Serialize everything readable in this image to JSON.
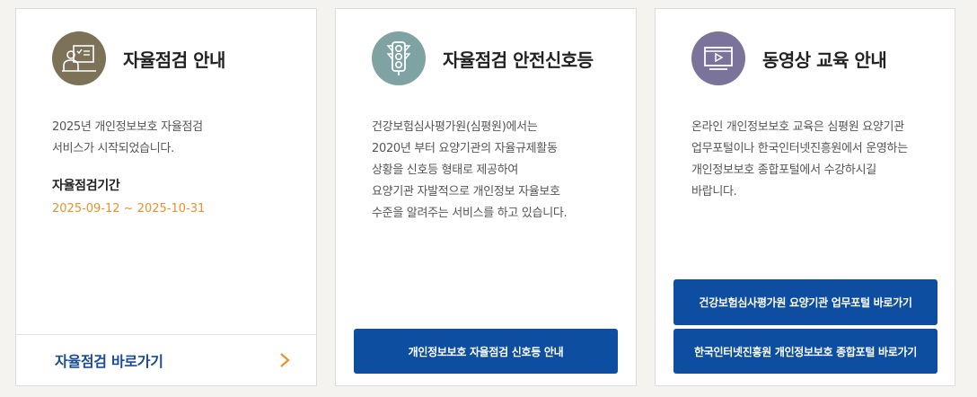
{
  "cards": [
    {
      "title": "자율점검 안내",
      "icon": "presentation-icon",
      "icon_bg": "#7b7258",
      "description": [
        "2025년 개인정보보호 자율점검",
        "서비스가 시작되었습니다."
      ],
      "period_label": "자율점검기간",
      "period_value": "2025-09-12 ~ 2025-10-31",
      "link_label": "자율점검 바로가기"
    },
    {
      "title": "자율점검 안전신호등",
      "icon": "traffic-light-icon",
      "icon_bg": "#7ea3a2",
      "description": [
        "건강보험심사평가원(심평원)에서는",
        "2020년 부터 요양기관의 자율규제활동",
        "상황을 신호등 형태로 제공하여",
        "요양기관 자발적으로 개인정보 자율보호",
        "수준을 알려주는 서비스를 하고 있습니다."
      ],
      "button_label": "개인정보보호 자율점검 신호등 안내"
    },
    {
      "title": "동영상 교육 안내",
      "icon": "video-player-icon",
      "icon_bg": "#7c739b",
      "description": [
        "온라인 개인정보보호 교육은 심평원 요양기관",
        "업무포털이나 한국인터넷진흥원에서 운영하는",
        "개인정보보호 종합포털에서 수강하시길",
        "바랍니다."
      ],
      "buttons": [
        "건강보험심사평가원 요양기관 업무포털 바로가기",
        "한국인터넷진흥원 개인정보보호 종합포털 바로가기"
      ]
    }
  ],
  "colors": {
    "accent_blue": "#0e4ea1",
    "link_blue": "#1a4b96",
    "date_orange": "#f0902a"
  }
}
